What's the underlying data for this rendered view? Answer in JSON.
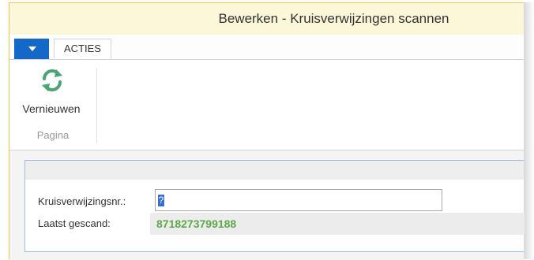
{
  "window": {
    "title": "Bewerken - Kruisverwijzingen scannen"
  },
  "ribbon": {
    "tabs": [
      {
        "label": "ACTIES"
      }
    ],
    "actions": [
      {
        "label": "Vernieuwen",
        "icon": "refresh-icon"
      }
    ],
    "group_label": "Pagina"
  },
  "form": {
    "cross_ref_label": "Kruisverwijzingsnr.:",
    "cross_ref_value": "?",
    "last_scanned_label": "Laatst gescand:",
    "last_scanned_value": "8718273799188"
  },
  "colors": {
    "accent": "#1468c8",
    "title_bar": "#fdf7d9",
    "frame_border": "#f0c44a",
    "refresh_icon": "#4aa573",
    "scanned_value": "#5ea84a"
  }
}
